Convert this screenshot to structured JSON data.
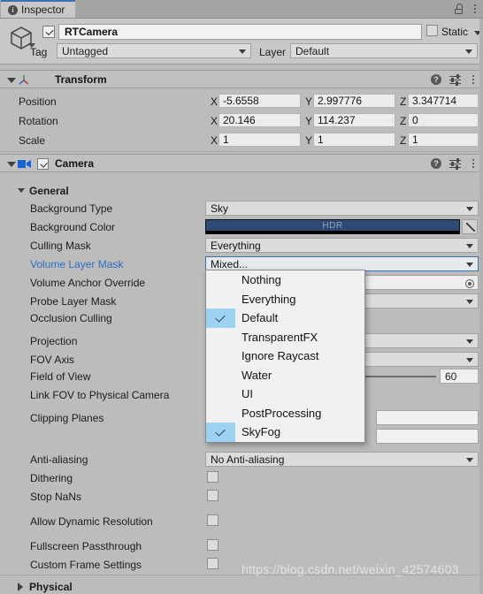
{
  "window": {
    "tab_label": "Inspector",
    "info_icon": "info-icon",
    "lock_icon": "lock-icon",
    "menu_icon": "vertical-dots-icon"
  },
  "object_header": {
    "gameobject_icon": "cube-icon",
    "enabled": true,
    "name": "RTCamera",
    "static_label": "Static",
    "static_checked": false,
    "tag_label": "Tag",
    "tag_value": "Untagged",
    "layer_label": "Layer",
    "layer_value": "Default"
  },
  "transform": {
    "title": "Transform",
    "icon": "transform-axis-icon",
    "help_icon": "help-icon",
    "preset_icon": "preset-sliders-icon",
    "menu_icon": "vertical-dots-icon",
    "rows": [
      {
        "label": "Position",
        "x": "-5.6558",
        "y": "2.997776",
        "z": "3.347714"
      },
      {
        "label": "Rotation",
        "x": "20.146",
        "y": "114.237",
        "z": "0"
      },
      {
        "label": "Scale",
        "x": "1",
        "y": "1",
        "z": "1"
      }
    ],
    "axis_labels": [
      "X",
      "Y",
      "Z"
    ]
  },
  "camera": {
    "title": "Camera",
    "icon": "camera-icon",
    "enabled": true,
    "help_icon": "help-icon",
    "preset_icon": "preset-sliders-icon",
    "menu_icon": "vertical-dots-icon",
    "general_section": "General",
    "props": {
      "background_type": {
        "label": "Background Type",
        "value": "Sky"
      },
      "background_color": {
        "label": "Background Color",
        "hdr_badge": "HDR",
        "color": "#2e4a74",
        "alpha_color": "#000000",
        "eyedropper_icon": "eyedropper-icon"
      },
      "culling_mask": {
        "label": "Culling Mask",
        "value": "Everything"
      },
      "volume_layer_mask": {
        "label": "Volume Layer Mask",
        "value": "Mixed...",
        "highlight_color": "#2b6fc4"
      },
      "volume_anchor_override": {
        "label": "Volume Anchor Override",
        "value": "",
        "picker_icon": "object-picker-icon"
      },
      "probe_layer_mask": {
        "label": "Probe Layer Mask",
        "value": ""
      },
      "occlusion_culling": {
        "label": "Occlusion Culling",
        "checked": false
      },
      "projection": {
        "label": "Projection",
        "value": ""
      },
      "fov_axis": {
        "label": "FOV Axis",
        "value": ""
      },
      "field_of_view": {
        "label": "Field of View",
        "value": "60"
      },
      "link_fov": {
        "label": "Link FOV to Physical Camera",
        "checked": false
      },
      "clipping_planes": {
        "label": "Clipping Planes",
        "near": "",
        "far": ""
      },
      "anti_aliasing": {
        "label": "Anti-aliasing",
        "value": "No Anti-aliasing"
      },
      "dithering": {
        "label": "Dithering",
        "checked": false
      },
      "stop_nans": {
        "label": "Stop NaNs",
        "checked": false
      },
      "allow_dynamic_resolution": {
        "label": "Allow Dynamic Resolution",
        "checked": false
      },
      "fullscreen_passthrough": {
        "label": "Fullscreen Passthrough",
        "checked": false
      },
      "custom_frame_settings": {
        "label": "Custom Frame Settings",
        "checked": false
      }
    },
    "physical_section": "Physical"
  },
  "layer_mask_dropdown": {
    "open": true,
    "items": [
      {
        "label": "Nothing",
        "checked": false
      },
      {
        "label": "Everything",
        "checked": false
      },
      {
        "label": "Default",
        "checked": true
      },
      {
        "label": "TransparentFX",
        "checked": false
      },
      {
        "label": "Ignore Raycast",
        "checked": false
      },
      {
        "label": "Water",
        "checked": false
      },
      {
        "label": "UI",
        "checked": false
      },
      {
        "label": "PostProcessing",
        "checked": false
      },
      {
        "label": "SkyFog",
        "checked": true
      }
    ],
    "check_highlight_color": "#9ed2f3"
  },
  "watermark": {
    "text": "https://blog.csdn.net/weixin_42574603"
  }
}
